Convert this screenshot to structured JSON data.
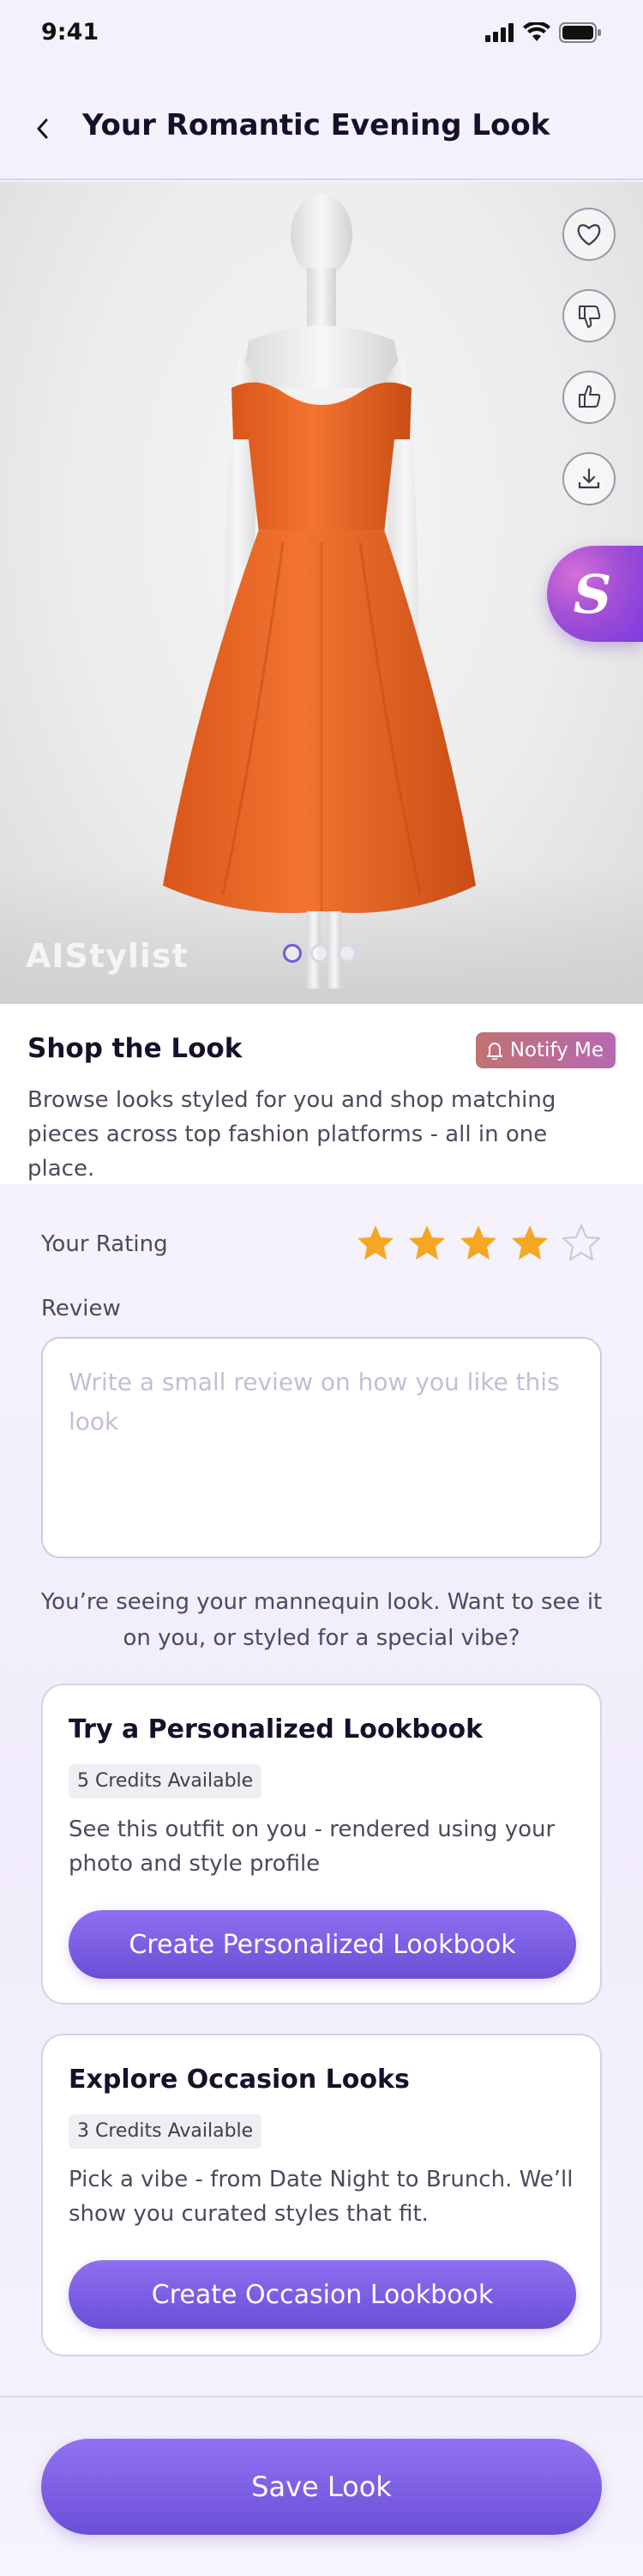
{
  "status_bar": {
    "time": "9:41"
  },
  "header": {
    "title": "Your Romantic Evening Look"
  },
  "hero": {
    "watermark": "AIStylist",
    "carousel_pages": 3,
    "carousel_active_index": 0,
    "stylist_badge": "S",
    "dress_color": "#ef6a24",
    "actions": [
      "heart-icon",
      "thumbs-down-icon",
      "thumbs-up-icon",
      "download-icon"
    ]
  },
  "shop": {
    "title": "Shop the Look",
    "notify_label": "Notify Me",
    "description": "Browse looks styled for you and shop matching pieces across top fashion platforms - all in one place."
  },
  "rating": {
    "label": "Your Rating",
    "value": 4,
    "max": 5,
    "star_color": "#f5a623"
  },
  "review": {
    "label": "Review",
    "placeholder": "Write a small review on how you like this look"
  },
  "prompt": "You’re seeing your mannequin look. Want to see it on you, or styled for a special vibe?",
  "cards": [
    {
      "title": "Try a Personalized Lookbook",
      "credits": "5 Credits Available",
      "description": "See this outfit on you - rendered using your photo and style profile",
      "button": "Create Personalized Lookbook"
    },
    {
      "title": "Explore Occasion Looks",
      "credits": "3 Credits Available",
      "description": "Pick a vibe - from Date Night to Brunch. We’ll show you curated styles that fit.",
      "button": "Create Occasion Lookbook"
    }
  ],
  "footer": {
    "save_label": "Save Look"
  },
  "colors": {
    "accent": "#6a4fd6",
    "notify_start": "#c07272",
    "notify_end": "#b768b1"
  }
}
